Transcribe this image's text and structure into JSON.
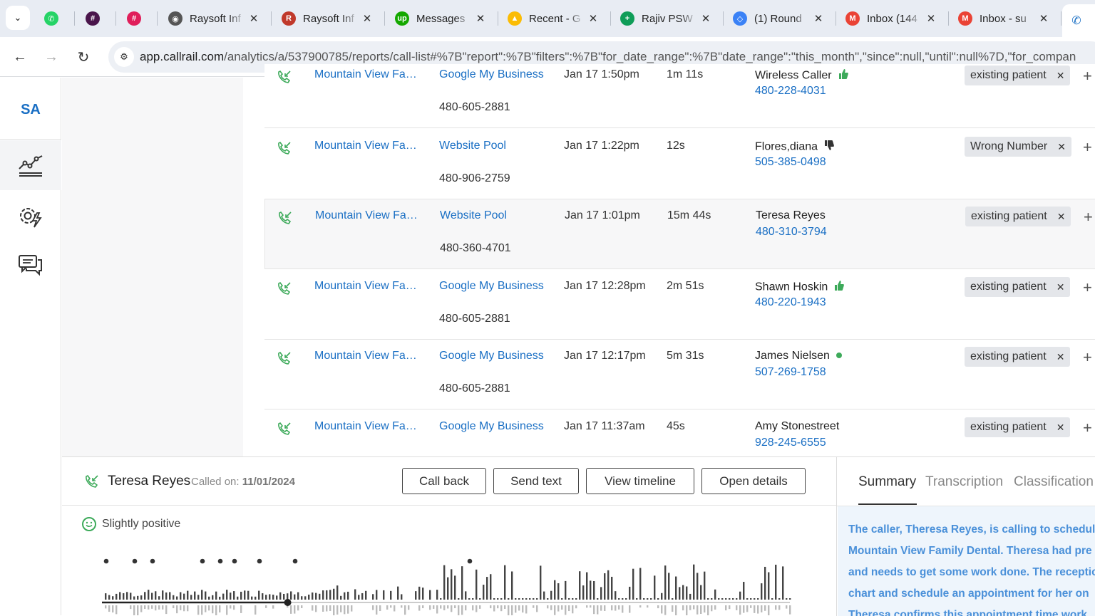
{
  "browser": {
    "tabs": [
      {
        "title": "",
        "favicon": "whatsapp-icon",
        "color": "#25d366"
      },
      {
        "title": "",
        "favicon": "slack-icon",
        "color": "#4a154b"
      },
      {
        "title": "",
        "favicon": "slack-icon",
        "color": "#e01e5a"
      },
      {
        "title": "Raysoft Inf",
        "favicon": "globe-icon",
        "color": "#555"
      },
      {
        "title": "Raysoft Inf",
        "favicon": "raysoft-icon",
        "color": "#c0392b"
      },
      {
        "title": "Messages",
        "favicon": "upwork-icon",
        "color": "#14a800"
      },
      {
        "title": "Recent - G",
        "favicon": "google-drive-icon",
        "color": "#fbbc04"
      },
      {
        "title": "Rajiv PSW",
        "favicon": "google-sheets-icon",
        "color": "#0f9d58"
      },
      {
        "title": "(1) Round",
        "favicon": "cube-icon",
        "color": "#3b82f6"
      },
      {
        "title": "Inbox (144",
        "favicon": "gmail-icon",
        "color": "#ea4335"
      },
      {
        "title": "Inbox - su",
        "favicon": "gmail-icon",
        "color": "#ea4335"
      }
    ],
    "url_host": "app.callrail.com",
    "url_path": "/analytics/a/537900785/reports/call-list#%7B\"report\":%7B\"filters\":%7B\"for_date_range\":%7B\"date_range\":\"this_month\",\"since\":null,\"until\":null%7D,\"for_compan"
  },
  "sidebar": {
    "avatar": "SA"
  },
  "calls": [
    {
      "company": "Mountain View Fa…",
      "source": "Google My Business",
      "tracking": "480-605-2881",
      "date": "Jan 17 1:50pm",
      "duration": "1m 11s",
      "caller": "Wireless Caller",
      "phone": "480-228-4031",
      "indicator": "thumbs-up",
      "tag": "existing patient"
    },
    {
      "company": "Mountain View Fa…",
      "source": "Website Pool",
      "tracking": "480-906-2759",
      "date": "Jan 17 1:22pm",
      "duration": "12s",
      "caller": "Flores,diana",
      "phone": "505-385-0498",
      "indicator": "thumbs-down",
      "tag": "Wrong Number"
    },
    {
      "company": "Mountain View Fa…",
      "source": "Website Pool",
      "tracking": "480-360-4701",
      "date": "Jan 17 1:01pm",
      "duration": "15m 44s",
      "caller": "Teresa Reyes",
      "phone": "480-310-3794",
      "indicator": "none",
      "tag": "existing patient"
    },
    {
      "company": "Mountain View Fa…",
      "source": "Google My Business",
      "tracking": "480-605-2881",
      "date": "Jan 17 12:28pm",
      "duration": "2m 51s",
      "caller": "Shawn Hoskin",
      "phone": "480-220-1943",
      "indicator": "thumbs-up",
      "tag": "existing patient"
    },
    {
      "company": "Mountain View Fa…",
      "source": "Google My Business",
      "tracking": "480-605-2881",
      "date": "Jan 17 12:17pm",
      "duration": "5m 31s",
      "caller": "James Nielsen",
      "phone": "507-269-1758",
      "indicator": "dot",
      "tag": "existing patient"
    },
    {
      "company": "Mountain View Fa…",
      "source": "Google My Business",
      "tracking": "",
      "date": "Jan 17 11:37am",
      "duration": "45s",
      "caller": "Amy Stonestreet",
      "phone": "928-245-6555",
      "indicator": "none",
      "tag": "existing patient"
    }
  ],
  "panel": {
    "caller_name": "Teresa Reyes",
    "called_on_label": "Called on:",
    "called_on_date": "11/01/2024",
    "buttons": {
      "call_back": "Call back",
      "send_text": "Send text",
      "view_timeline": "View timeline",
      "open_details": "Open details"
    },
    "sentiment": "Slightly positive",
    "playback_progress": 0.27,
    "tabs": {
      "summary": "Summary",
      "transcription": "Transcription",
      "classification": "Classification"
    },
    "summary_lines": [
      "The caller, Theresa Reyes, is calling to schedule",
      "Mountain View Family Dental. Theresa had pre",
      "and needs to get some work done. The receptio",
      "chart and schedule an appointment for her on",
      "Theresa confirms this appointment time work"
    ]
  },
  "colors": {
    "link": "#1a6fc4",
    "positive": "#3daa5a",
    "summary_text": "#4a90d9"
  }
}
